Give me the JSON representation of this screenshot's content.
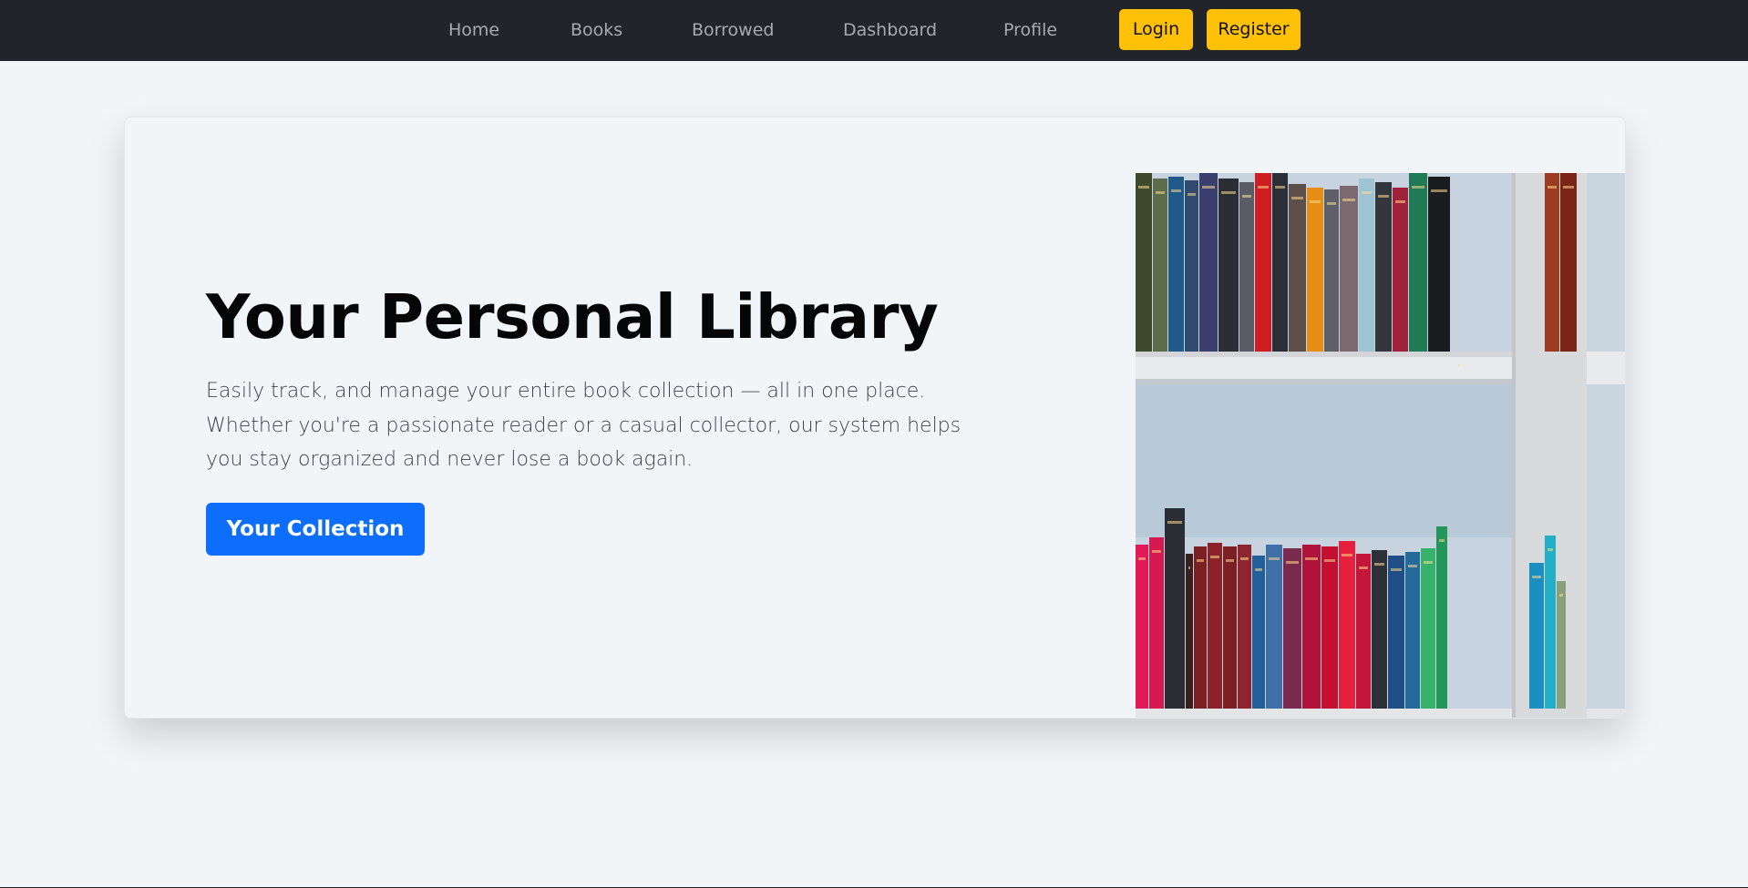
{
  "nav": {
    "links": [
      "Home",
      "Books",
      "Borrowed",
      "Dashboard",
      "Profile"
    ],
    "login_label": "Login",
    "register_label": "Register"
  },
  "hero": {
    "title": "Your Personal Library",
    "description": "Easily track, and manage your entire book collection — all in one place. Whether you're a passionate reader or a casual collector, our system helps you stay organized and never lose a book again.",
    "cta_label": "Your Collection",
    "image_alt": "bookshelf-photo"
  },
  "colors": {
    "navbar": "#212529",
    "accent_yellow": "#ffc107",
    "primary_blue": "#0d6efd",
    "page_bg": "#f2f5f8"
  }
}
